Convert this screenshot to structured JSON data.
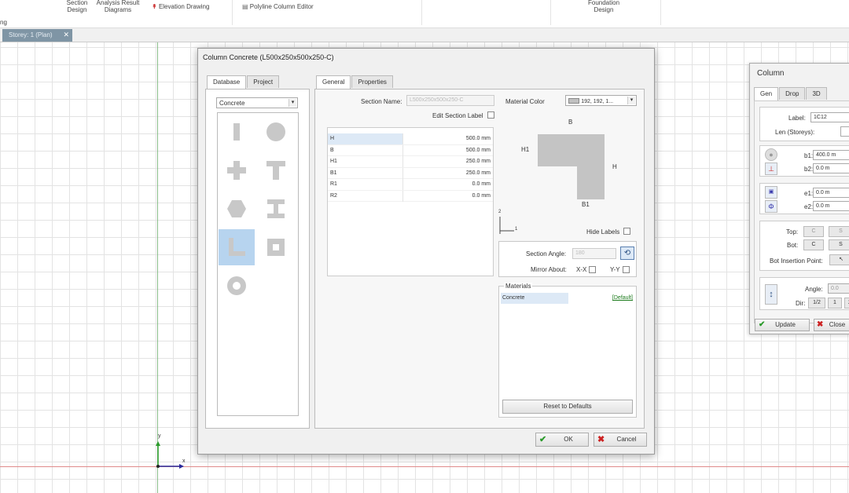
{
  "ribbon": {
    "section_design": "Section\nDesign",
    "analysis_result": "Analysis Result\nDiagrams",
    "elevation_drawing": "Elevation Drawing",
    "polyline_editor": "Polyline Column Editor",
    "foundation_design": "Foundation\nDesign",
    "left_cut": "ng"
  },
  "storey_tab": {
    "label": "Storey: 1 (Plan)",
    "close": "✕"
  },
  "dialog": {
    "title": "Column Concrete (L500x250x500x250-C)",
    "left_tabs": [
      "Database",
      "Project"
    ],
    "material_select": "Concrete",
    "right_tabs": [
      "General",
      "Properties"
    ],
    "section_name_label": "Section Name:",
    "section_name_value": "L500x250x500x250-C",
    "edit_label": "Edit Section Label",
    "material_color_label": "Material Color",
    "material_color_value": "192, 192, 1...",
    "params": [
      {
        "name": "H",
        "value": "500.0 mm"
      },
      {
        "name": "B",
        "value": "500.0 mm"
      },
      {
        "name": "H1",
        "value": "250.0 mm"
      },
      {
        "name": "B1",
        "value": "250.0 mm"
      },
      {
        "name": "R1",
        "value": "0.0 mm"
      },
      {
        "name": "R2",
        "value": "0.0 mm"
      }
    ],
    "preview_labels": {
      "b": "B",
      "h1": "H1",
      "h": "H",
      "b1": "B1",
      "axis2": "2",
      "axis1": "1"
    },
    "hide_labels": "Hide Labels",
    "section_angle_label": "Section Angle:",
    "section_angle_value": "180",
    "mirror_label": "Mirror About:",
    "mirror_x": "X-X",
    "mirror_y": "Y-Y",
    "materials_group": "Materials",
    "material_row": "Concrete",
    "material_default": "[Default]",
    "reset_button": "Reset to Defaults",
    "ok_button": "OK",
    "cancel_button": "Cancel"
  },
  "column_panel": {
    "title": "Column",
    "tabs": [
      "Gen",
      "Drop",
      "3D"
    ],
    "label_label": "Label:",
    "label_value": "1C12",
    "len_label": "Len (Storeys):",
    "b1_label": "b1:",
    "b1_value": "400.0 m",
    "b2_label": "b2:",
    "b2_value": "0.0 m",
    "e1_label": "e1:",
    "e1_value": "0.0 m",
    "e2_label": "e2:",
    "e2_value": "0.0 m",
    "top_label": "Top:",
    "bot_label": "Bot:",
    "top_c": "C",
    "top_s": "S",
    "bot_c": "C",
    "bot_s": "S",
    "bot_insertion_label": "Bot Insertion Point:",
    "angle_label": "Angle:",
    "angle_value": "0.0",
    "dir_label": "Dir:",
    "dir_half": "1/2",
    "dir_one": "1",
    "dir_two": "2",
    "update_button": "Update",
    "close_button": "Close"
  },
  "canvas": {
    "axis_y": "y",
    "axis_x": "x"
  }
}
